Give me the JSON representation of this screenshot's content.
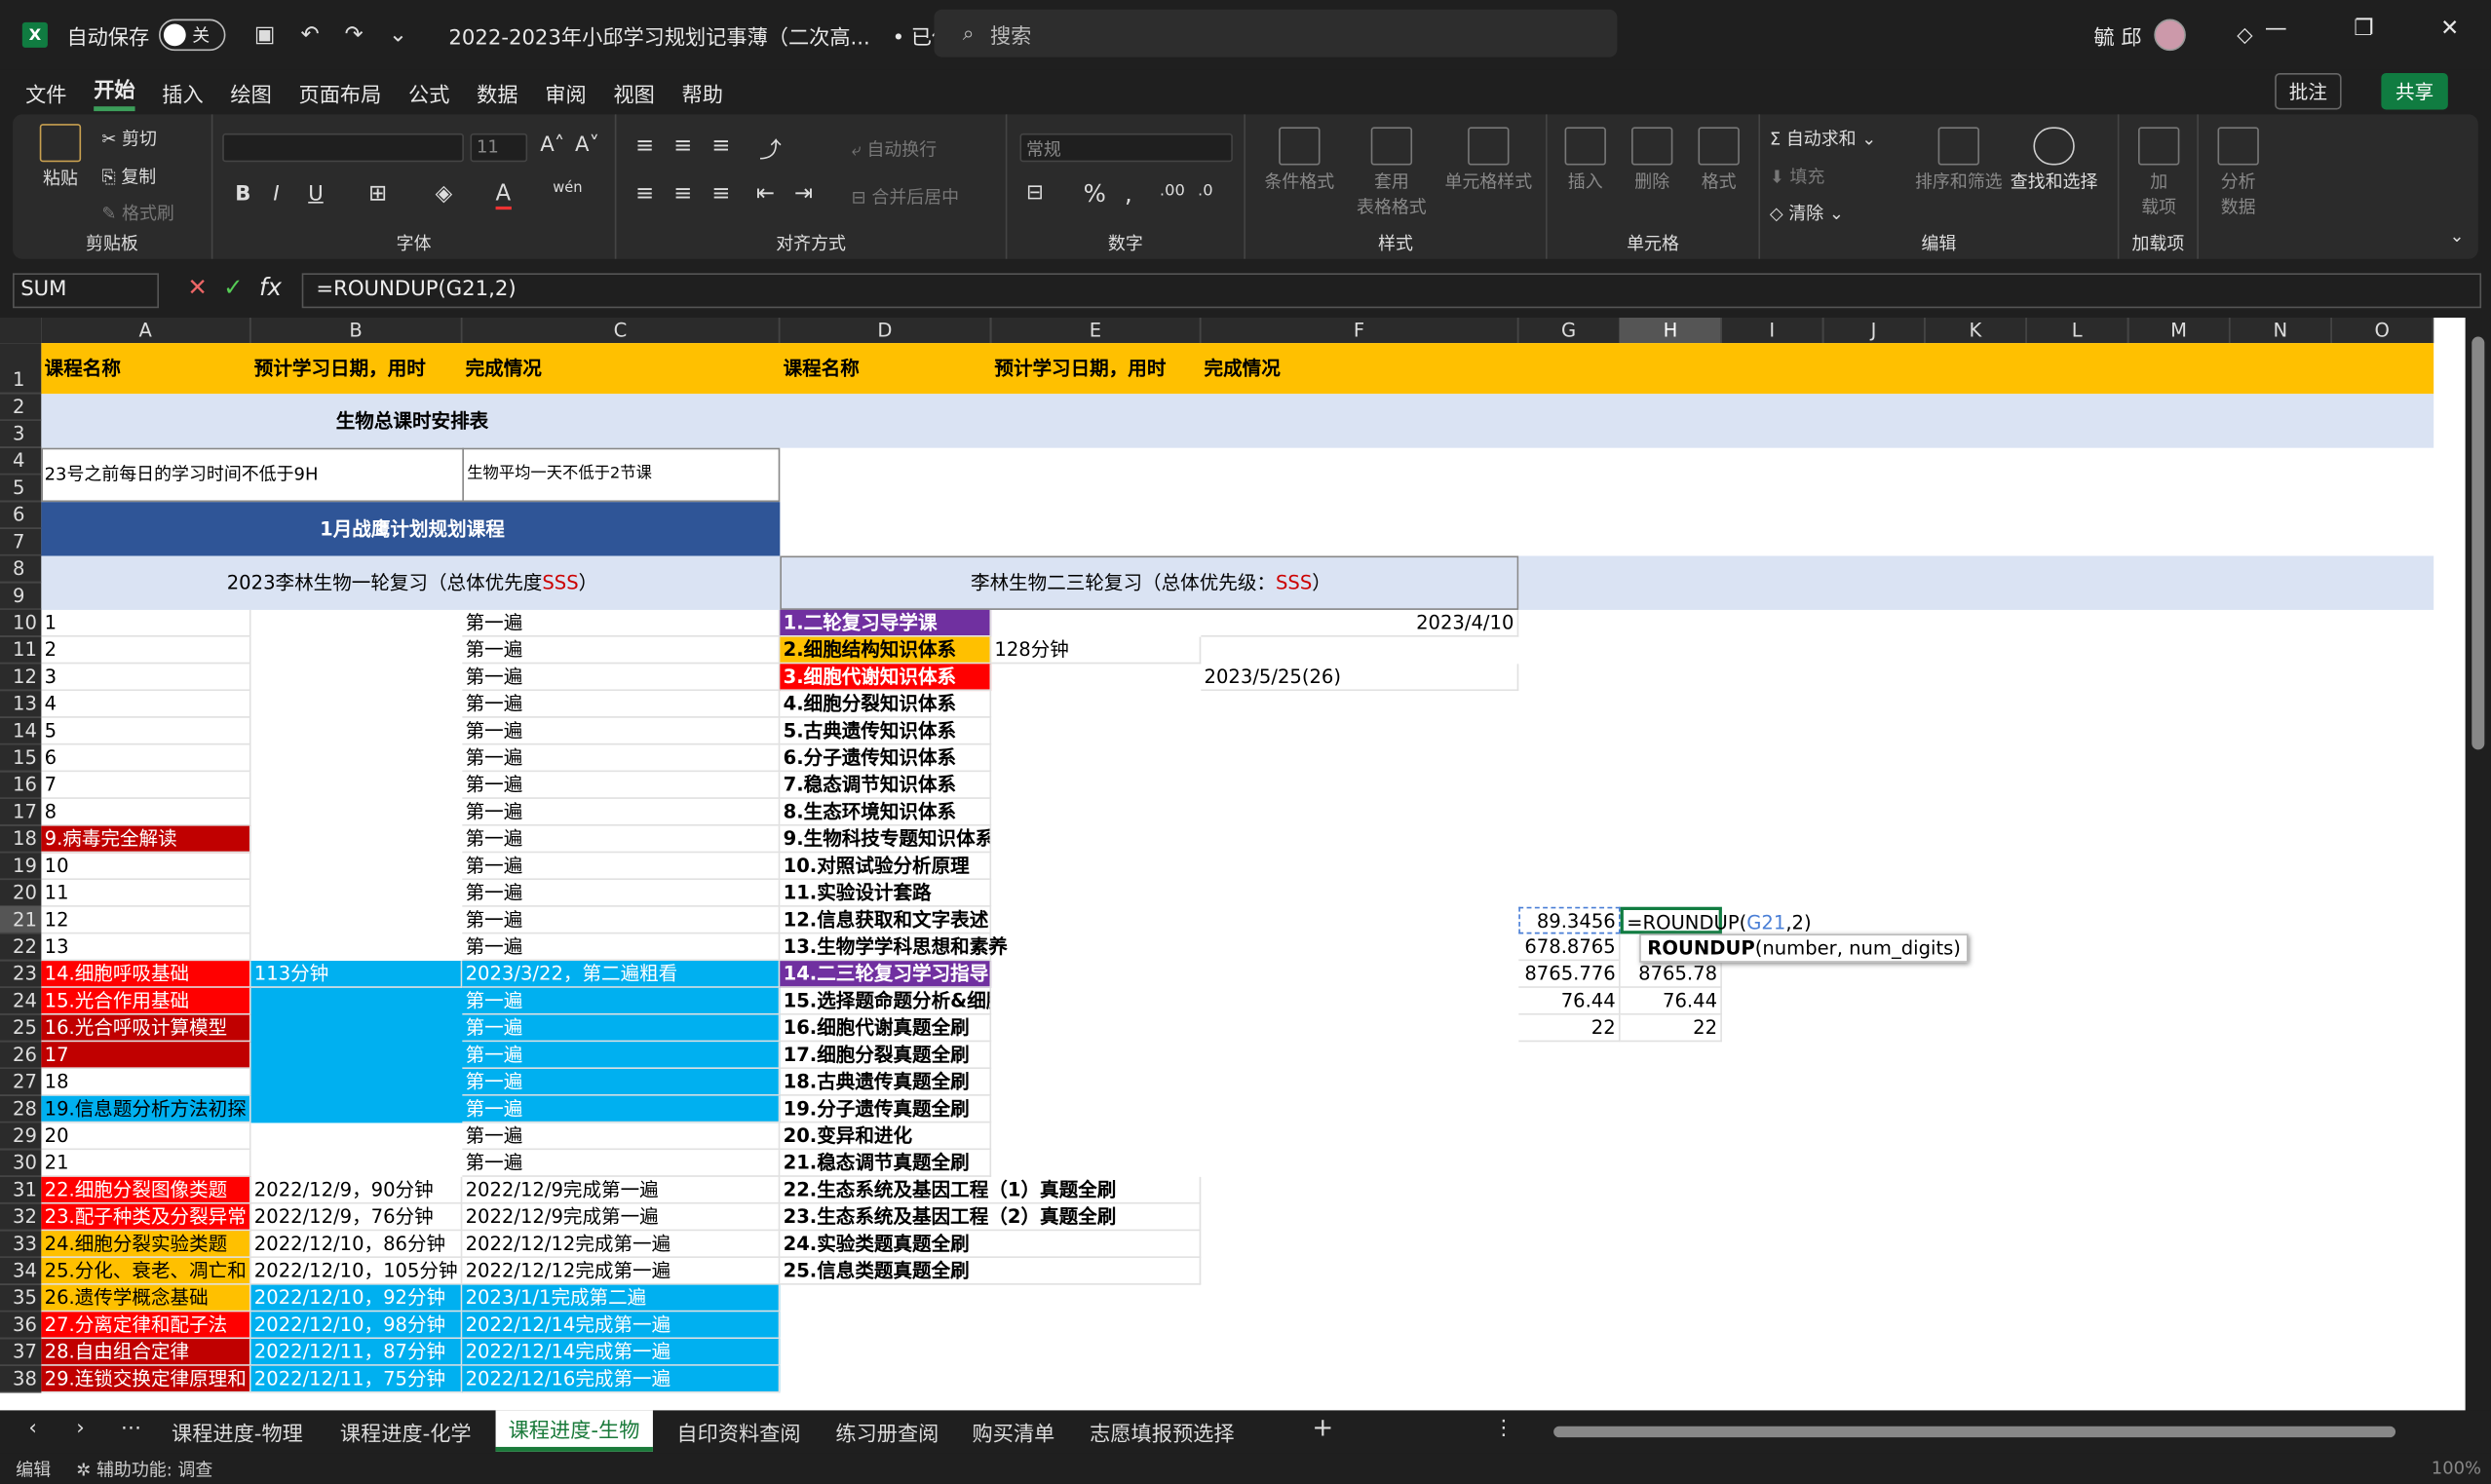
{
  "titlebar": {
    "autosave_label": "自动保存",
    "autosave_state": "关",
    "doc_title": "2022-2023年小邱学习规划记事薄（二次高...",
    "saved_label": "• 已保存",
    "search_placeholder": "搜索",
    "user_name": "毓 邱"
  },
  "menu": [
    "文件",
    "开始",
    "插入",
    "绘图",
    "页面布局",
    "公式",
    "数据",
    "审阅",
    "视图",
    "帮助"
  ],
  "menu_right": {
    "comments": "批注",
    "share": "共享"
  },
  "ribbon": {
    "clipboard": {
      "label": "剪贴板",
      "paste": "粘贴",
      "cut": "剪切",
      "copy": "复制",
      "format_painter": "格式刷"
    },
    "font": {
      "label": "字体",
      "size": "11",
      "bold": "B",
      "italic": "I",
      "underline": "U"
    },
    "alignment": {
      "label": "对齐方式",
      "wrap": "自动换行",
      "merge": "合并后居中"
    },
    "number": {
      "label": "数字",
      "format": "常规",
      "percent": "%"
    },
    "styles": {
      "label": "样式",
      "cond": "条件格式",
      "table1": "套用",
      "table2": "表格格式",
      "cell": "单元格样式"
    },
    "cells": {
      "label": "单元格",
      "insert": "插入",
      "delete": "删除",
      "format": "格式"
    },
    "editing": {
      "label": "编辑",
      "autosum": "自动求和",
      "fill": "填充",
      "clear": "清除",
      "sort": "排序和筛选",
      "find": "查找和选择"
    },
    "addins": {
      "label": "加载项",
      "a1": "加",
      "a2": "载项"
    },
    "analysis": {
      "a1": "分析",
      "a2": "数据"
    }
  },
  "namebox": "SUM",
  "formula": "=ROUNDUP(G21,2)",
  "columns": [
    "A",
    "B",
    "C",
    "D",
    "E",
    "F",
    "G",
    "H",
    "I",
    "J",
    "K",
    "L",
    "M",
    "N",
    "O"
  ],
  "rows": [
    "1",
    "2",
    "3",
    "4",
    "5",
    "6",
    "7",
    "8",
    "9",
    "10",
    "11",
    "12",
    "13",
    "14",
    "15",
    "16",
    "17",
    "18",
    "19",
    "20",
    "21",
    "22",
    "23",
    "24",
    "25",
    "26",
    "27",
    "28",
    "29",
    "30",
    "31",
    "32",
    "33",
    "34",
    "35",
    "36",
    "37",
    "38"
  ],
  "header_row": {
    "a": "课程名称",
    "b": "预计学习日期，用时",
    "c": "完成情况",
    "d": "课程名称",
    "e": "预计学习日期，用时",
    "f": "完成情况"
  },
  "banner": {
    "title": "生物总课时安排表",
    "note1": "23号之前每日的学习时间不低于9H",
    "note2": "生物平均一天不低于2节课",
    "plan": "1月战鹰计划规划课程",
    "left_section": "2023李林生物一轮复习（总体优先度",
    "left_sss": "SSS",
    "left_end": "）",
    "right_section": "李林生物二三轮复习（总体优先级：",
    "right_sss": "SSS",
    "right_end": "）"
  },
  "colA": [
    "1",
    "2",
    "3",
    "4",
    "5",
    "6",
    "7",
    "8",
    "9.病毒完全解读",
    "10",
    "11",
    "12",
    "13",
    "14.细胞呼吸基础",
    "15.光合作用基础",
    "16.光合呼吸计算模型",
    "17",
    "18",
    "19.信息题分析方法初探",
    "20",
    "21",
    "22.细胞分裂图像类题",
    "23.配子种类及分裂异常",
    "24.细胞分裂实验类题",
    "25.分化、衰老、凋亡和",
    "26.遗传学概念基础",
    "27.分离定律和配子法",
    "28.自由组合定律",
    "29.连锁交换定律原理和"
  ],
  "colB": {
    "23": "113分钟",
    "31": "2022/12/9，90分钟",
    "32": "2022/12/9，76分钟",
    "33": "2022/12/10，86分钟",
    "34": "2022/12/10，105分钟",
    "35": "2022/12/10，92分钟",
    "36": "2022/12/10，98分钟",
    "37": "2022/12/11，87分钟",
    "38": "2022/12/11，75分钟"
  },
  "colC": {
    "10": "第一遍",
    "11": "第一遍",
    "12": "第一遍",
    "13": "第一遍",
    "14": "第一遍",
    "15": "第一遍",
    "16": "第一遍",
    "17": "第一遍",
    "18": "第一遍",
    "19": "第一遍",
    "20": "第一遍",
    "21": "第一遍",
    "22": "第一遍",
    "23": "2023/3/22，第二遍粗看",
    "24": "第一遍",
    "25": "第一遍",
    "26": "第一遍",
    "27": "第一遍",
    "28": "第一遍",
    "29": "第一遍",
    "30": "第一遍",
    "31": "2022/12/9完成第一遍",
    "32": "2022/12/9完成第一遍",
    "33": "2022/12/12完成第一遍",
    "34": "2022/12/12完成第一遍",
    "35": "2023/1/1完成第二遍",
    "36": "2022/12/14完成第一遍",
    "37": "2022/12/14完成第一遍",
    "38": "2022/12/16完成第一遍"
  },
  "colD": [
    "1.二轮复习导学课",
    "2.细胞结构知识体系",
    "3.细胞代谢知识体系",
    "4.细胞分裂知识体系",
    "5.古典遗传知识体系",
    "6.分子遗传知识体系",
    "7.稳态调节知识体系",
    "8.生态环境知识体系",
    "9.生物科技专题知识体系",
    "10.对照试验分析原理",
    "11.实验设计套路",
    "12.信息获取和文字表述",
    "13.生物学学科思想和素养",
    "14.二三轮复习学习指导",
    "15.选择题命题分析&细胞结构",
    "16.细胞代谢真题全刷",
    "17.细胞分裂真题全刷",
    "18.古典遗传真题全刷",
    "19.分子遗传真题全刷",
    "20.变异和进化",
    "21.稳态调节真题全刷",
    "22.生态系统及基因工程（1）真题全刷",
    "23.生态系统及基因工程（2）真题全刷",
    "24.实验类题真题全刷",
    "25.信息类题真题全刷"
  ],
  "colE": {
    "11": "128分钟"
  },
  "colF": {
    "10": "2023/4/10",
    "12": "2023/5/25(26)"
  },
  "colG": {
    "21": "89.3456",
    "22": "678.8765",
    "23": "8765.776",
    "24": "76.44",
    "25": "22"
  },
  "colH": {
    "21": "=ROUNDUP(G21,2)",
    "23": "8765.78",
    "24": "76.44",
    "25": "22"
  },
  "tooltip": "ROUNDUP(number, num_digits)",
  "tabs": [
    "课程进度-物理",
    "课程进度-化学",
    "课程进度-生物",
    "自印资料查阅",
    "练习册查阅",
    "购买清单",
    "志愿填报预选择"
  ],
  "status": {
    "mode": "编辑",
    "accessibility": "辅助功能: 调查",
    "zoom": "100%"
  },
  "colors": {
    "yellow": "#ffc000",
    "red": "#ff0000",
    "darkred": "#c00000",
    "purple": "#7030a0",
    "blue": "#00b0f0",
    "navy": "#2f5597",
    "lightblue": "#dae3f3",
    "accent": "#107c41"
  }
}
